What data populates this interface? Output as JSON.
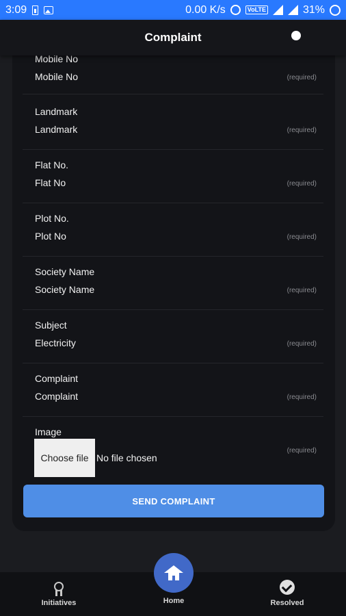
{
  "status_bar": {
    "time": "3:09",
    "speed": "0.00 K/s",
    "network_tag": "VoLTE",
    "battery": "31%"
  },
  "header": {
    "title": "Complaint",
    "icon": "gear-icon"
  },
  "form": {
    "fields": [
      {
        "label": "Mobile No",
        "value": "Mobile No",
        "hint": "(required)"
      },
      {
        "label": "Landmark",
        "value": "Landmark",
        "hint": "(required)"
      },
      {
        "label": "Flat No.",
        "value": "Flat No",
        "hint": "(required)"
      },
      {
        "label": "Plot No.",
        "value": "Plot No",
        "hint": "(required)"
      },
      {
        "label": "Society Name",
        "value": "Society Name",
        "hint": "(required)"
      },
      {
        "label": "Subject",
        "value": "Electricity",
        "hint": "(required)"
      },
      {
        "label": "Complaint",
        "value": "Complaint",
        "hint": "(required)"
      }
    ],
    "image": {
      "label": "Image",
      "button": "Choose file",
      "status": "No file chosen",
      "hint": "(required)"
    },
    "submit": "SEND COMPLAINT"
  },
  "bottom_nav": {
    "items": [
      {
        "label": "Initiatives",
        "icon": "award-icon"
      },
      {
        "label": "Home",
        "icon": "home-icon"
      },
      {
        "label": "Resolved",
        "icon": "check-circle-icon"
      }
    ]
  },
  "colors": {
    "status_bar": "#2979ff",
    "accent_button": "#4f8ee6",
    "home_fab": "#4169c8",
    "background": "#1b1c20"
  }
}
